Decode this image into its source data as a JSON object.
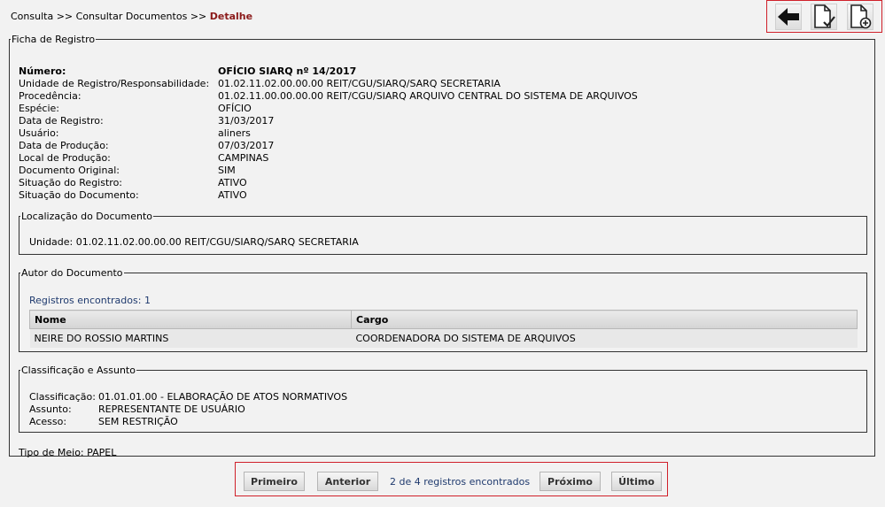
{
  "breadcrumb": {
    "item1": "Consulta",
    "sep1": ">>",
    "item2": "Consultar Documentos",
    "sep2": ">>",
    "current": "Detalhe"
  },
  "toolbar": {
    "icons": [
      "arrow-left-icon",
      "document-check-icon",
      "document-add-icon"
    ]
  },
  "ficha": {
    "legend": "Ficha de Registro",
    "rows": [
      {
        "label": "Número:",
        "value": "OFÍCIO SIARQ nº 14/2017"
      },
      {
        "label": "Unidade de Registro/Responsabilidade:",
        "value": "01.02.11.02.00.00.00 REIT/CGU/SIARQ/SARQ SECRETARIA"
      },
      {
        "label": "Procedência:",
        "value": "01.02.11.00.00.00.00 REIT/CGU/SIARQ ARQUIVO CENTRAL DO SISTEMA DE ARQUIVOS"
      },
      {
        "label": "Espécie:",
        "value": "OFÍCIO"
      },
      {
        "label": "Data de Registro:",
        "value": "31/03/2017"
      },
      {
        "label": "Usuário:",
        "value": "aliners"
      },
      {
        "label": "Data de Produção:",
        "value": "07/03/2017"
      },
      {
        "label": "Local de Produção:",
        "value": "CAMPINAS"
      },
      {
        "label": "Documento Original:",
        "value": "SIM"
      },
      {
        "label": "Situação do Registro:",
        "value": "ATIVO"
      },
      {
        "label": "Situação do Documento:",
        "value": "ATIVO"
      }
    ]
  },
  "localizacao": {
    "legend": "Localização do Documento",
    "label": "Unidade:",
    "value": "01.02.11.02.00.00.00 REIT/CGU/SIARQ/SARQ SECRETARIA"
  },
  "autor": {
    "legend": "Autor do Documento",
    "count": "Registros encontrados: 1",
    "columns": [
      "Nome",
      "Cargo"
    ],
    "rows": [
      [
        "NEIRE DO ROSSIO MARTINS",
        "COORDENADORA DO SISTEMA DE ARQUIVOS"
      ]
    ]
  },
  "classificacao": {
    "legend": "Classificação e Assunto",
    "rows": [
      {
        "label": "Classificação:",
        "value": "01.01.01.00 - ELABORAÇÃO DE ATOS NORMATIVOS"
      },
      {
        "label": "Assunto:",
        "value": "REPRESENTANTE DE USUÁRIO"
      },
      {
        "label": "Acesso:",
        "value": "SEM RESTRIÇÃO"
      }
    ]
  },
  "tipo_meio": {
    "label": "Tipo de Meio:",
    "value": "PAPEL"
  },
  "pager": {
    "first": "Primeiro",
    "prev": "Anterior",
    "info": "2 de 4 registros encontrados",
    "next": "Próximo",
    "last": "Último"
  }
}
